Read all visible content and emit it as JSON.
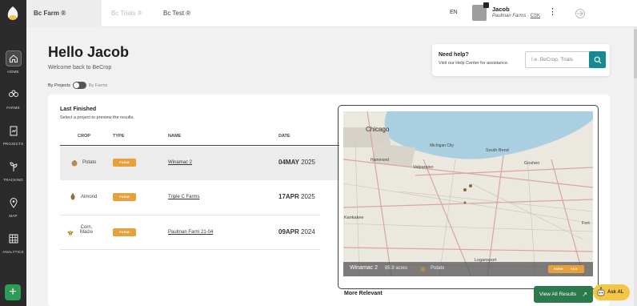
{
  "nav": {
    "items": [
      {
        "label": "HOME",
        "icon": "home-icon"
      },
      {
        "label": "FARMS",
        "icon": "farms-icon"
      },
      {
        "label": "PROJECTS",
        "icon": "projects-icon"
      },
      {
        "label": "TRACKING",
        "icon": "tracking-icon"
      },
      {
        "label": "MAP",
        "icon": "map-pin-icon"
      },
      {
        "label": "ANALYTICS",
        "icon": "analytics-icon"
      }
    ],
    "add_label": "+"
  },
  "tabs": [
    {
      "label": "Bc Farm ®",
      "state": "active"
    },
    {
      "label": "Bc Trials ®",
      "state": "disabled"
    },
    {
      "label": "Bc Test ®",
      "state": "normal"
    }
  ],
  "header": {
    "language": "EN",
    "user_name": "Jacob",
    "org_name": "Paulman Farms",
    "org_sep": " · ",
    "org_code": "CSK",
    "menu_glyph": "⋮"
  },
  "greeting": {
    "title": "Hello Jacob",
    "subtitle": "Welcome back to BeCrop"
  },
  "view_toggle": {
    "left_label": "By Projects",
    "right_label": "By Farms"
  },
  "help": {
    "title": "Need help?",
    "subtitle": "Visit our Help Center for assistance.",
    "placeholder": "I.e. BeCrop, Trials"
  },
  "last_finished": {
    "title": "Last Finished",
    "subtitle": "Select a project to preview the results.",
    "columns": {
      "crop": "CROP",
      "type": "TYPE",
      "name": "NAME",
      "date": "DATE"
    },
    "rows": [
      {
        "crop": "Potato",
        "crop_line2": "",
        "type": "FARM",
        "name": "Winamac 2",
        "day_month": "04MAY",
        "year": "2025"
      },
      {
        "crop": "Almond",
        "crop_line2": "",
        "type": "FARM",
        "name": "Triple C Farms",
        "day_month": "17APR",
        "year": "2025"
      },
      {
        "crop": "Corn,",
        "crop_line2": "Maize",
        "type": "FARM",
        "name": "Paulman Farm 21-04",
        "day_month": "09APR",
        "year": "2024"
      }
    ]
  },
  "map": {
    "labels": {
      "chicago": "Chicago",
      "michigan_city": "Michigan City",
      "south_bend": "South Bend",
      "goshen": "Goshen",
      "valparaiso": "Valparaiso",
      "hammond": "Hammond",
      "kankakee": "Kankakee",
      "logansport": "Logansport",
      "fort": "Fort"
    },
    "farm_name": "Winamac 2",
    "acres": "85.9 acres",
    "crop": "Potato",
    "badge_type": "FARM",
    "badge_version": "V3.5"
  },
  "more_relevant": "More Relevant",
  "view_all": {
    "label": "View All Results",
    "arrow": "↗"
  },
  "ask_ai": {
    "label": "Ask AL"
  },
  "colors": {
    "sidebar": "#2b2b2b",
    "accent_green": "#2f9a55",
    "teal": "#168a8f",
    "farm_badge": "#e8a03a",
    "ask_ai": "#f5c544"
  }
}
